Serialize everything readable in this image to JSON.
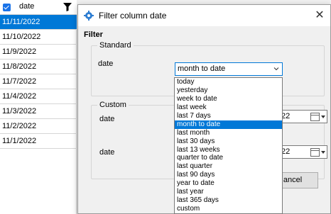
{
  "grid": {
    "column_label": "date",
    "rows": [
      "11/11/2022",
      "11/10/2022",
      "11/9/2022",
      "11/8/2022",
      "11/7/2022",
      "11/4/2022",
      "11/3/2022",
      "11/2/2022",
      "11/1/2022"
    ],
    "selected_index": 0
  },
  "dialog": {
    "title": "Filter column date",
    "close_label": "✕",
    "filter_label": "Filter",
    "standard": {
      "title": "Standard",
      "field_label": "date",
      "selected_value": "month to date"
    },
    "custom": {
      "title": "Custom",
      "field1_label": "date",
      "field1_value": "22",
      "field2_label": "date",
      "field2_value": "22"
    },
    "cancel_label": "ancel"
  },
  "dropdown": {
    "options": [
      "today",
      "yesterday",
      "week to date",
      "last week",
      "last 7 days",
      "month to date",
      "last month",
      "last 30 days",
      "last 13 weeks",
      "quarter to date",
      "last quarter",
      "last 90 days",
      "year to date",
      "last year",
      "last 365 days",
      "custom"
    ],
    "selected_index": 5
  },
  "colors": {
    "accent": "#0078d7",
    "selected_text": "#ffffff"
  }
}
